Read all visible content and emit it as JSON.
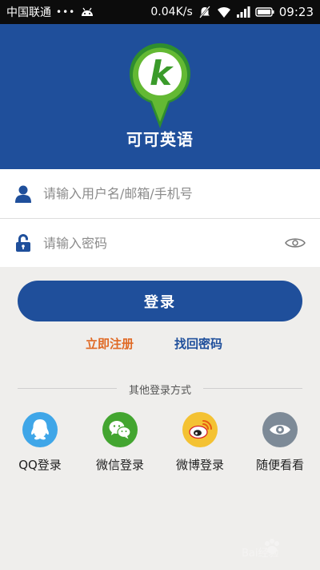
{
  "status_bar": {
    "carrier": "中国联通",
    "dots": "•••",
    "speed": "0.04K/s",
    "time": "09:23"
  },
  "header": {
    "logo_letter": "k",
    "app_name": "可可英语",
    "background_color": "#1f4f9b"
  },
  "form": {
    "username_placeholder": "请输入用户名/邮箱/手机号",
    "username_value": "",
    "password_placeholder": "请输入密码",
    "password_value": ""
  },
  "actions": {
    "login_label": "登录",
    "register_label": "立即注册",
    "forgot_label": "找回密码"
  },
  "other_login": {
    "title": "其他登录方式",
    "options": [
      {
        "label": "QQ登录",
        "icon": "qq-icon",
        "color": "#3fa6e8"
      },
      {
        "label": "微信登录",
        "icon": "wechat-icon",
        "color": "#43a530"
      },
      {
        "label": "微博登录",
        "icon": "weibo-icon",
        "color": "#f4c233"
      },
      {
        "label": "随便看看",
        "icon": "eye-icon",
        "color": "#7d8a97"
      }
    ]
  },
  "watermark": "Bai经验"
}
